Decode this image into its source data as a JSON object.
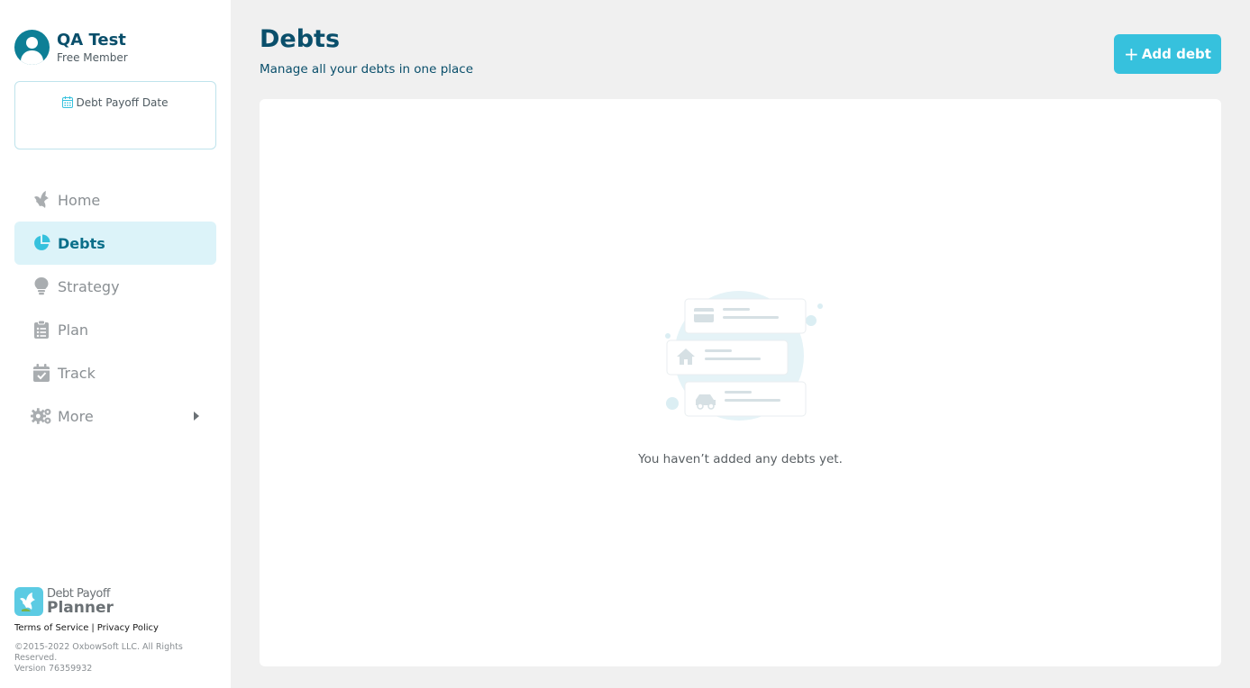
{
  "user": {
    "name": "QA Test",
    "membership": "Free Member"
  },
  "payoff_widget": {
    "label": "Debt Payoff Date",
    "icon": "calendar-icon"
  },
  "nav": {
    "items": [
      {
        "label": "Home",
        "icon": "bird-icon",
        "active": false
      },
      {
        "label": "Debts",
        "icon": "pie-chart-icon",
        "active": true
      },
      {
        "label": "Strategy",
        "icon": "lightbulb-icon",
        "active": false
      },
      {
        "label": "Plan",
        "icon": "clipboard-list-icon",
        "active": false
      },
      {
        "label": "Track",
        "icon": "calendar-check-icon",
        "active": false
      },
      {
        "label": "More",
        "icon": "gears-icon",
        "active": false,
        "has_submenu": true
      }
    ]
  },
  "brand": {
    "line1": "Debt Payoff",
    "line2": "Planner"
  },
  "footer": {
    "terms": "Terms of Service",
    "separator": "|",
    "privacy": "Privacy Policy",
    "copyright": "©2015-2022 OxbowSoft LLC. All Rights Reserved.",
    "version": "Version 76359932"
  },
  "page": {
    "title": "Debts",
    "subtitle": "Manage all your debts in one place",
    "add_button": "Add debt",
    "empty_message": "You haven’t added any debts yet."
  },
  "colors": {
    "primary": "#36c1dd",
    "heading": "#0a4f6b",
    "active_nav_bg": "#dcf3f9",
    "background": "#f0f0f0"
  }
}
